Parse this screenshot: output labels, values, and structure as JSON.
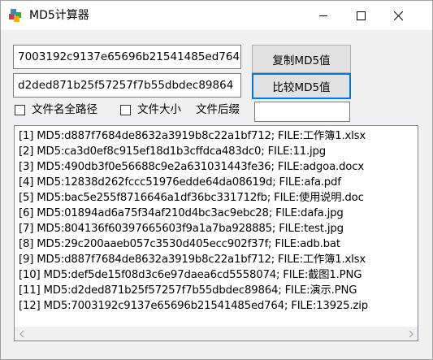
{
  "window": {
    "title": "MD5计算器",
    "icons": [
      "app-icon",
      "minimize-icon",
      "maximize-icon",
      "close-icon"
    ]
  },
  "inputs": {
    "hash1": "7003192c9137e65696b21541485ed764",
    "hash2": "d2ded871b25f57257f7b55dbdec89864",
    "suffix": ""
  },
  "buttons": {
    "copy": "复制MD5值",
    "compare": "比较MD5值"
  },
  "options": {
    "full_path": "文件名全路径",
    "file_size": "文件大小",
    "suffix_label": "文件后缀"
  },
  "list": {
    "items": [
      "[1] MD5:d887f7684de8632a3919b8c22a1bf712; FILE:工作簿1.xlsx",
      "[2] MD5:ca3d0ef8c915ef18d1b3cffdca483dc0; FILE:11.jpg",
      "[3] MD5:490db3f0e56688c9e2a631031443fe36; FILE:adgoa.docx",
      "[4] MD5:12838d262fccc51976edde64da08619d; FILE:afa.pdf",
      "[5] MD5:bac5e255f8716646a1df36bc331712fb; FILE:使用说明.doc",
      "[6] MD5:01894ad6a75f34af210d4bc3ac9ebc28; FILE:dafa.jpg",
      "[7] MD5:804136f60397665603f9a1a7ba928885; FILE:test.jpg",
      "[8] MD5:29c200aaeb057c3530d405ecc902f37f; FILE:adb.bat",
      "[9] MD5:d887f7684de8632a3919b8c22a1bf712; FILE:工作簿1.xlsx",
      "[10] MD5:def5de15f08d3c6e97daea6cd5558074; FILE:截图1.PNG",
      "[11] MD5:d2ded871b25f57257f7b55dbdec89864; FILE:演示.PNG",
      "[12] MD5:7003192c9137e65696b21541485ed764; FILE:13925.zip"
    ]
  },
  "colors": {
    "accent": "#0078d7",
    "window_bg": "#f0f0f0"
  }
}
